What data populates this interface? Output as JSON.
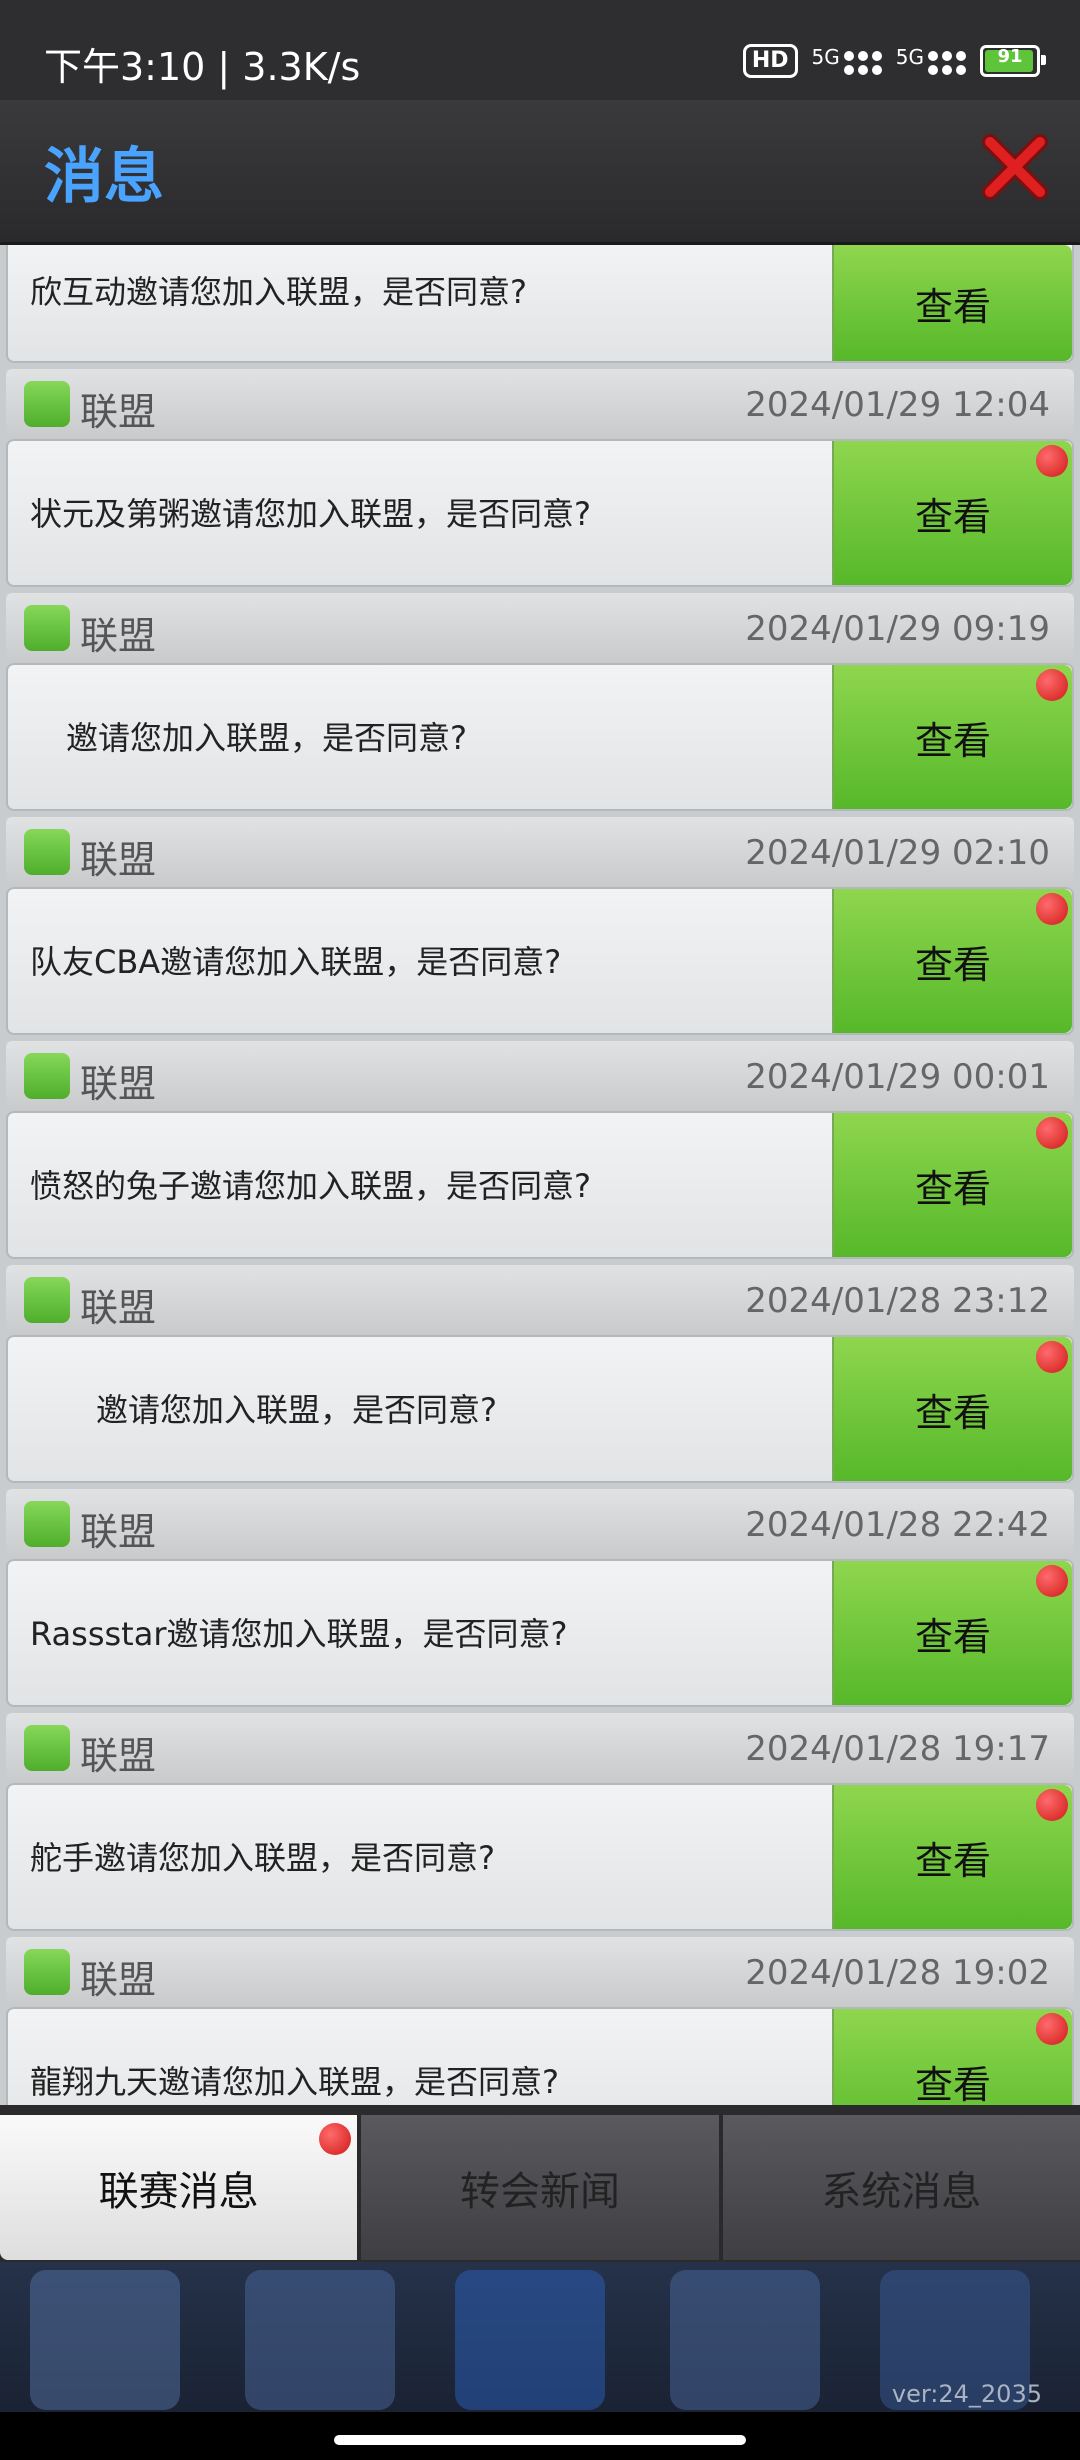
{
  "status_bar": {
    "time": "下午3:10 | 3.3K/s",
    "hd": "HD",
    "sig1": "5G",
    "sig2": "5G",
    "battery": "91"
  },
  "header": {
    "title": "消息"
  },
  "first_partial": {
    "text": "欣互动邀请您加入联盟，是否同意?",
    "button": "查看"
  },
  "messages": [
    {
      "category": "联盟",
      "time": "2024/01/29 12:04",
      "text": "状元及第粥邀请您加入联盟，是否同意?",
      "button": "查看"
    },
    {
      "category": "联盟",
      "time": "2024/01/29 09:19",
      "text": "邀请您加入联盟，是否同意?",
      "button": "查看"
    },
    {
      "category": "联盟",
      "time": "2024/01/29 02:10",
      "text": "队友CBA邀请您加入联盟，是否同意?",
      "button": "查看"
    },
    {
      "category": "联盟",
      "time": "2024/01/29 00:01",
      "text": "愤怒的兔子邀请您加入联盟，是否同意?",
      "button": "查看"
    },
    {
      "category": "联盟",
      "time": "2024/01/28 23:12",
      "text": "邀请您加入联盟，是否同意?",
      "button": "查看"
    },
    {
      "category": "联盟",
      "time": "2024/01/28 22:42",
      "text": "Rassstar邀请您加入联盟，是否同意?",
      "button": "查看"
    },
    {
      "category": "联盟",
      "time": "2024/01/28 19:17",
      "text": "舵手邀请您加入联盟，是否同意?",
      "button": "查看"
    },
    {
      "category": "联盟",
      "time": "2024/01/28 19:02",
      "text": "龍翔九天邀请您加入联盟，是否同意?",
      "button": "查看"
    }
  ],
  "tabs": [
    {
      "label": "联赛消息"
    },
    {
      "label": "转会新闻"
    },
    {
      "label": "系统消息"
    }
  ],
  "version": "ver:24_2035",
  "colors": {
    "accent_green": "#56b829",
    "title_blue": "#4aa3ff",
    "notify_red": "#d01818"
  }
}
